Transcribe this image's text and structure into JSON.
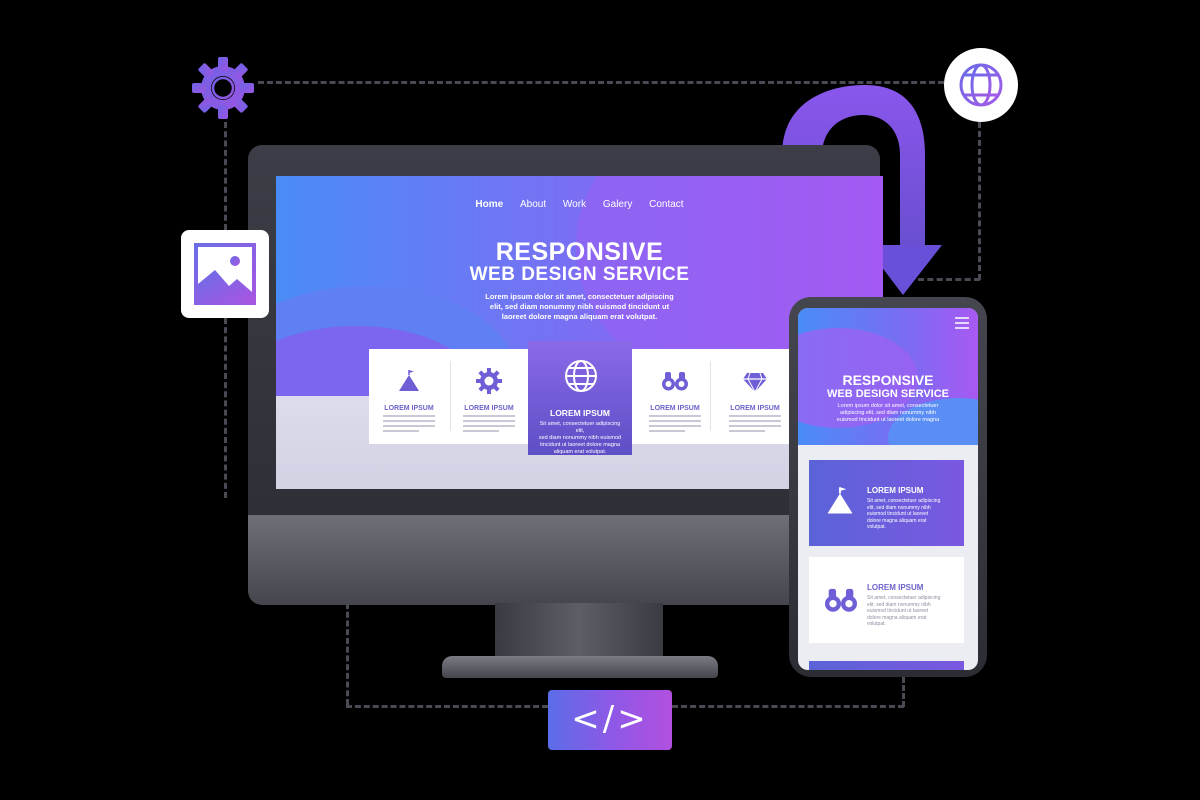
{
  "desktop_site": {
    "nav": [
      "Home",
      "About",
      "Work",
      "Galery",
      "Contact"
    ],
    "hero_title_line1": "RESPONSIVE",
    "hero_title_line2": "WEB DESIGN SERVICE",
    "hero_desc_line1": "Lorem ipsum dolor sit amet, consectetuer adipiscing",
    "hero_desc_line2": "elit, sed diam nonummy nibh euismod tincidunt ut",
    "hero_desc_line3": "laoreet dolore magna aliquam erat volutpat.",
    "cards": [
      {
        "icon": "mountain-flag-icon",
        "title": "LOREM IPSUM"
      },
      {
        "icon": "gear-icon",
        "title": "LOREM IPSUM"
      },
      {
        "icon": "globe-icon",
        "title": "LOREM IPSUM",
        "featured": true,
        "desc_line1": "Sit amet, consectetuer adipiscing elit,",
        "desc_line2": "sed diam nonummy nibh euismod",
        "desc_line3": "tincidunt ut laoreet dolore magna",
        "desc_line4": "aliquam erat volutpat."
      },
      {
        "icon": "binoculars-icon",
        "title": "LOREM IPSUM"
      },
      {
        "icon": "diamond-icon",
        "title": "LOREM IPSUM"
      }
    ]
  },
  "mobile_site": {
    "hero_title_line1": "RESPONSIVE",
    "hero_title_line2": "WEB DESIGN SERVICE",
    "hero_desc_line1": "Lorem ipsum dolor sit amet, consectetuer",
    "hero_desc_line2": "adipiscing elit, sed diam nonummy nibh",
    "hero_desc_line3": "euismod tincidunt ut laoreet dolore magna",
    "cards": [
      {
        "icon": "mountain-flag-icon",
        "title": "LOREM IPSUM",
        "desc_line1": "Sit amet, consectetuer adipiscing",
        "desc_line2": "elit, sed diam nonummy nibh",
        "desc_line3": "euismod tincidunt ut laoreet",
        "desc_line4": "dolore magna aliquam erat",
        "desc_line5": "volutpat."
      },
      {
        "icon": "binoculars-icon",
        "title": "LOREM IPSUM",
        "desc_line1": "Sit amet, consectetuer adipiscing",
        "desc_line2": "elit, sed diam nonummy nibh",
        "desc_line3": "euismod tincidunt ut laoreet",
        "desc_line4": "dolore magna aliquam erat",
        "desc_line5": "volutpat."
      }
    ]
  },
  "floating_icons": {
    "gear": "gear-icon",
    "globe": "globe-icon",
    "image": "image-icon",
    "code": "</>"
  },
  "colors": {
    "accent_blue": "#4a8cf7",
    "accent_purple": "#8b5cf6",
    "accent_violet": "#b055f2",
    "card_title": "#6b63c9"
  }
}
